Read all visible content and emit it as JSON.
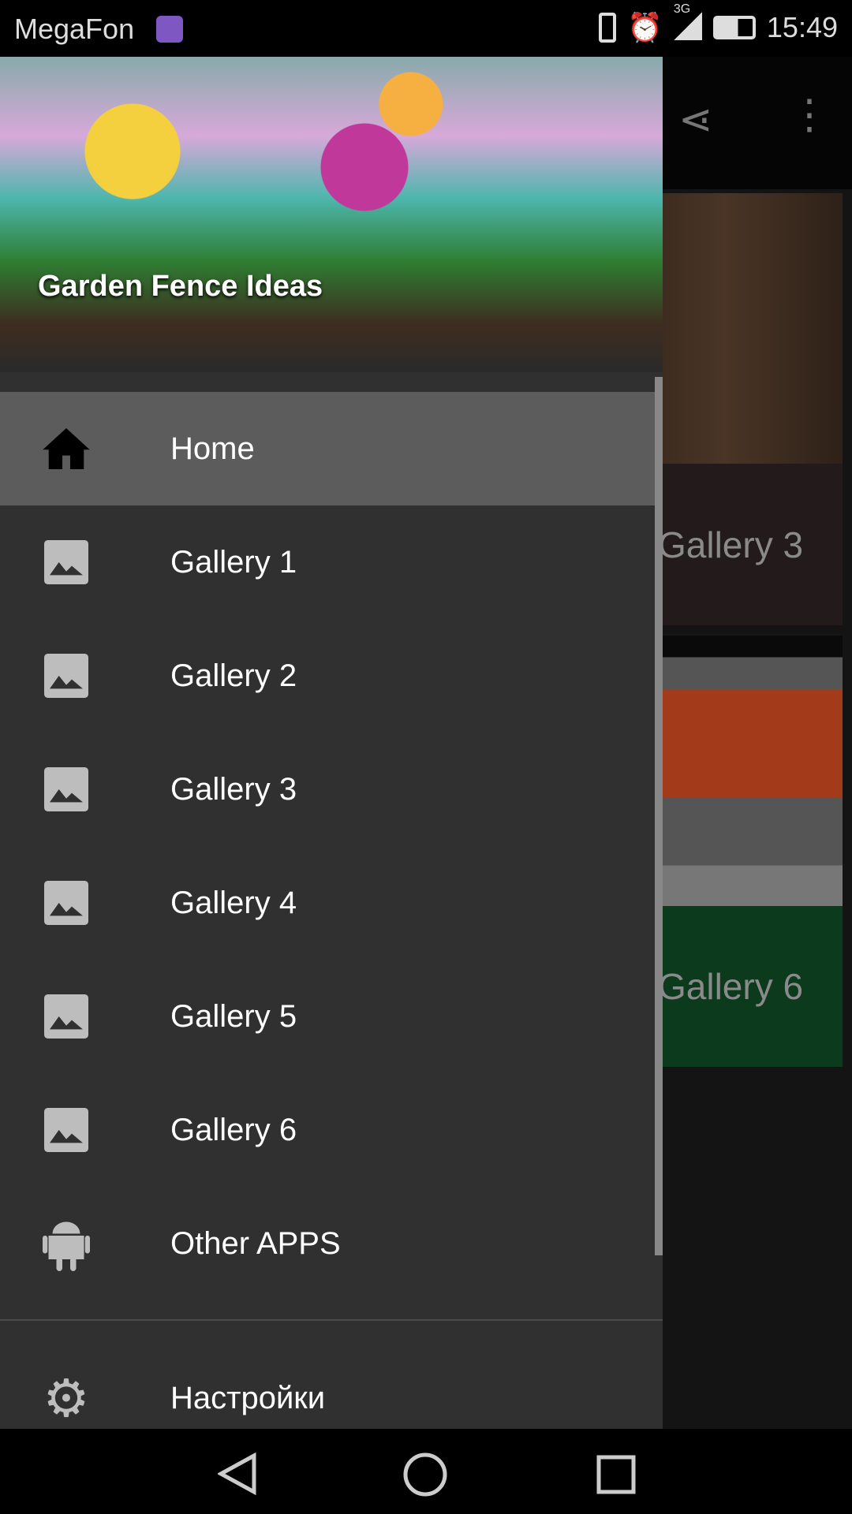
{
  "status_bar": {
    "carrier": "MegaFon",
    "network": "3G",
    "time": "15:49"
  },
  "background": {
    "cards": [
      {
        "label": "Gallery 3"
      },
      {
        "label": "Gallery 6"
      }
    ]
  },
  "drawer": {
    "header_title": "Garden Fence Ideas",
    "items": [
      {
        "label": "Home",
        "icon": "home-icon",
        "active": true
      },
      {
        "label": "Gallery 1",
        "icon": "image-icon"
      },
      {
        "label": "Gallery 2",
        "icon": "image-icon"
      },
      {
        "label": "Gallery 3",
        "icon": "image-icon"
      },
      {
        "label": "Gallery 4",
        "icon": "image-icon"
      },
      {
        "label": "Gallery 5",
        "icon": "image-icon"
      },
      {
        "label": "Gallery 6",
        "icon": "image-icon"
      },
      {
        "label": "Other APPS",
        "icon": "android-icon"
      }
    ],
    "settings_label": "Настройки"
  }
}
